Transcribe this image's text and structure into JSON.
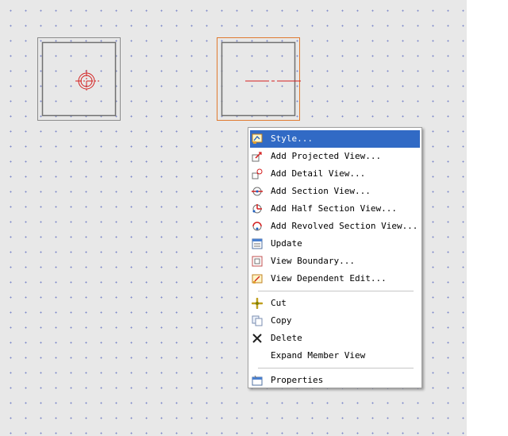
{
  "menu": {
    "items": [
      {
        "label": "Style...",
        "icon": "style-icon"
      },
      {
        "label": "Add Projected View...",
        "icon": "projected-view-icon"
      },
      {
        "label": "Add Detail View...",
        "icon": "detail-view-icon"
      },
      {
        "label": "Add Section View...",
        "icon": "section-view-icon"
      },
      {
        "label": "Add Half Section View...",
        "icon": "half-section-view-icon"
      },
      {
        "label": "Add Revolved Section View...",
        "icon": "revolved-section-view-icon"
      },
      {
        "label": "Update",
        "icon": "update-icon"
      },
      {
        "label": "View Boundary...",
        "icon": "view-boundary-icon"
      },
      {
        "label": "View Dependent Edit...",
        "icon": "dependent-edit-icon"
      },
      {
        "label": "Cut",
        "icon": "cut-icon"
      },
      {
        "label": "Copy",
        "icon": "copy-icon"
      },
      {
        "label": "Delete",
        "icon": "delete-icon"
      },
      {
        "label": "Expand Member View",
        "icon": ""
      },
      {
        "label": "Properties",
        "icon": "properties-icon"
      }
    ],
    "selected_index": 0
  },
  "colors": {
    "highlight": "#316ac5",
    "view_border": "#808080",
    "selected_view_border": "#e07a30",
    "center_line": "#d42020",
    "grid_dot": "#7d87c9",
    "canvas_bg": "#e8e8e8"
  }
}
